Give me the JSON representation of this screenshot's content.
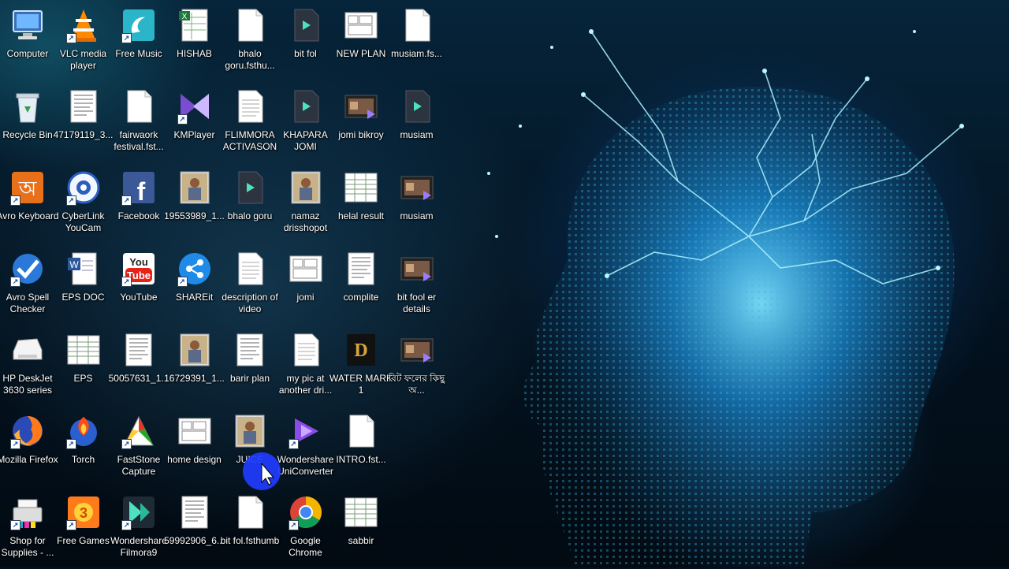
{
  "desktop": {
    "icons": [
      {
        "label": "Computer",
        "icon": "computer-icon",
        "col": 0,
        "row": 0,
        "shortcut": false
      },
      {
        "label": "VLC media player",
        "icon": "vlc-icon",
        "col": 1,
        "row": 0,
        "shortcut": true
      },
      {
        "label": "Free Music",
        "icon": "free-music-icon",
        "col": 2,
        "row": 0,
        "shortcut": true
      },
      {
        "label": "HISHAB",
        "icon": "excel-file-icon",
        "col": 3,
        "row": 0,
        "shortcut": false
      },
      {
        "label": "bhalo goru.fsthu...",
        "icon": "blank-file-icon",
        "col": 4,
        "row": 0,
        "shortcut": false
      },
      {
        "label": "bit fol",
        "icon": "filmora-project-icon",
        "col": 5,
        "row": 0,
        "shortcut": false
      },
      {
        "label": "NEW PLAN",
        "icon": "image-file-icon",
        "col": 6,
        "row": 0,
        "shortcut": false
      },
      {
        "label": "musiam.fs...",
        "icon": "blank-file-icon",
        "col": 7,
        "row": 0,
        "shortcut": false
      },
      {
        "label": "Recycle Bin",
        "icon": "recycle-bin-icon",
        "col": 0,
        "row": 1,
        "shortcut": false
      },
      {
        "label": "47179119_3...",
        "icon": "document-image-icon",
        "col": 1,
        "row": 1,
        "shortcut": false
      },
      {
        "label": "fairwaork festival.fst...",
        "icon": "blank-file-icon",
        "col": 2,
        "row": 1,
        "shortcut": false
      },
      {
        "label": "KMPlayer",
        "icon": "kmplayer-icon",
        "col": 3,
        "row": 1,
        "shortcut": true
      },
      {
        "label": "FLIMMORA ACTIVASON",
        "icon": "text-file-icon",
        "col": 4,
        "row": 1,
        "shortcut": false
      },
      {
        "label": "KHAPARA JOMI",
        "icon": "filmora-project-icon",
        "col": 5,
        "row": 1,
        "shortcut": false
      },
      {
        "label": "jomi bikroy",
        "icon": "video-file-icon",
        "col": 6,
        "row": 1,
        "shortcut": false
      },
      {
        "label": "musiam",
        "icon": "filmora-project-icon",
        "col": 7,
        "row": 1,
        "shortcut": false
      },
      {
        "label": "Avro Keyboard",
        "icon": "avro-keyboard-icon",
        "col": 0,
        "row": 2,
        "shortcut": true
      },
      {
        "label": "CyberLink YouCam",
        "icon": "youcam-icon",
        "col": 1,
        "row": 2,
        "shortcut": true
      },
      {
        "label": "Facebook",
        "icon": "facebook-icon",
        "col": 2,
        "row": 2,
        "shortcut": true
      },
      {
        "label": "19553989_1...",
        "icon": "photo-file-icon",
        "col": 3,
        "row": 2,
        "shortcut": false
      },
      {
        "label": "bhalo goru",
        "icon": "filmora-project-icon",
        "col": 4,
        "row": 2,
        "shortcut": false
      },
      {
        "label": "namaz drisshopot",
        "icon": "photo-file-icon",
        "col": 5,
        "row": 2,
        "shortcut": false
      },
      {
        "label": "helal result",
        "icon": "spreadsheet-image-icon",
        "col": 6,
        "row": 2,
        "shortcut": false
      },
      {
        "label": "musiam",
        "icon": "video-file-icon",
        "col": 7,
        "row": 2,
        "shortcut": false
      },
      {
        "label": "Avro Spell Checker",
        "icon": "avro-spell-checker-icon",
        "col": 0,
        "row": 3,
        "shortcut": true
      },
      {
        "label": "EPS DOC",
        "icon": "word-file-icon",
        "col": 1,
        "row": 3,
        "shortcut": false
      },
      {
        "label": "YouTube",
        "icon": "youtube-icon",
        "col": 2,
        "row": 3,
        "shortcut": true
      },
      {
        "label": "SHAREit",
        "icon": "shareit-icon",
        "col": 3,
        "row": 3,
        "shortcut": true
      },
      {
        "label": "description of video",
        "icon": "text-file-icon",
        "col": 4,
        "row": 3,
        "shortcut": false
      },
      {
        "label": "jomi",
        "icon": "image-file-icon",
        "col": 5,
        "row": 3,
        "shortcut": false
      },
      {
        "label": "complite",
        "icon": "document-image-icon",
        "col": 6,
        "row": 3,
        "shortcut": false
      },
      {
        "label": "bit fool er details",
        "icon": "video-file-icon",
        "col": 7,
        "row": 3,
        "shortcut": false
      },
      {
        "label": "HP DeskJet 3630 series",
        "icon": "printer-icon",
        "col": 0,
        "row": 4,
        "shortcut": false
      },
      {
        "label": "EPS",
        "icon": "spreadsheet-image-icon",
        "col": 1,
        "row": 4,
        "shortcut": false
      },
      {
        "label": "50057631_1...",
        "icon": "document-image-icon",
        "col": 2,
        "row": 4,
        "shortcut": false
      },
      {
        "label": "16729391_1...",
        "icon": "photo-file-icon",
        "col": 3,
        "row": 4,
        "shortcut": false
      },
      {
        "label": "barir plan",
        "icon": "document-image-icon",
        "col": 4,
        "row": 4,
        "shortcut": false
      },
      {
        "label": "my pic at another dri...",
        "icon": "text-file-icon",
        "col": 5,
        "row": 4,
        "shortcut": false
      },
      {
        "label": "WATER MARK 1",
        "icon": "watermark-image-icon",
        "col": 6,
        "row": 4,
        "shortcut": false
      },
      {
        "label": "বিট ফলের কিছু অ...",
        "icon": "video-file-icon",
        "col": 7,
        "row": 4,
        "shortcut": false
      },
      {
        "label": "Mozilla Firefox",
        "icon": "firefox-icon",
        "col": 0,
        "row": 5,
        "shortcut": true
      },
      {
        "label": "Torch",
        "icon": "torch-icon",
        "col": 1,
        "row": 5,
        "shortcut": true
      },
      {
        "label": "FastStone Capture",
        "icon": "faststone-icon",
        "col": 2,
        "row": 5,
        "shortcut": true
      },
      {
        "label": "home design",
        "icon": "image-file-icon",
        "col": 3,
        "row": 5,
        "shortcut": false
      },
      {
        "label": "JUICE",
        "icon": "photo-file-icon",
        "col": 4,
        "row": 5,
        "shortcut": false
      },
      {
        "label": "Wondershare UniConverter",
        "icon": "uniconverter-icon",
        "col": 5,
        "row": 5,
        "shortcut": true
      },
      {
        "label": "INTRO.fst...",
        "icon": "blank-file-icon",
        "col": 6,
        "row": 5,
        "shortcut": false
      },
      {
        "label": "Shop for Supplies - ...",
        "icon": "printer-shop-icon",
        "col": 0,
        "row": 6,
        "shortcut": true
      },
      {
        "label": "Free Games",
        "icon": "free-games-icon",
        "col": 1,
        "row": 6,
        "shortcut": true
      },
      {
        "label": "Wondershare Filmora9",
        "icon": "filmora-icon",
        "col": 2,
        "row": 6,
        "shortcut": true
      },
      {
        "label": "59992906_6...",
        "icon": "document-image-icon",
        "col": 3,
        "row": 6,
        "shortcut": false
      },
      {
        "label": "bit fol.fsthumb",
        "icon": "blank-file-icon",
        "col": 4,
        "row": 6,
        "shortcut": false
      },
      {
        "label": "Google Chrome",
        "icon": "chrome-icon",
        "col": 5,
        "row": 6,
        "shortcut": true
      },
      {
        "label": "sabbir",
        "icon": "spreadsheet-image-icon",
        "col": 6,
        "row": 6,
        "shortcut": false
      }
    ]
  },
  "colors": {
    "highlight_circle": "#1f3cff",
    "wallpaper_glow": "#28aaff"
  }
}
